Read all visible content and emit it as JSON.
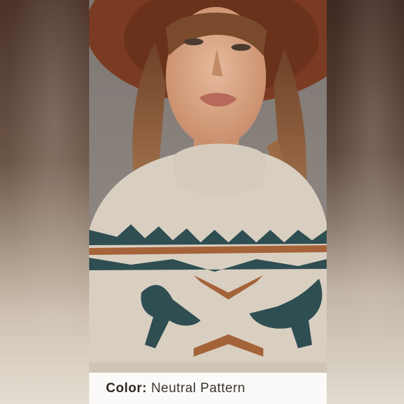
{
  "caption": {
    "label": "Color:",
    "value": "Neutral Pattern"
  },
  "colors": {
    "hat": "#7a3b22",
    "sweater": "#d9cfc1",
    "pattern_teal": "#2f4e52",
    "pattern_rust": "#a5633a",
    "hair": "#8a5a38",
    "skin": "#d8a88a"
  },
  "photo": {
    "subject": "model-wearing-fair-isle-sweater"
  }
}
